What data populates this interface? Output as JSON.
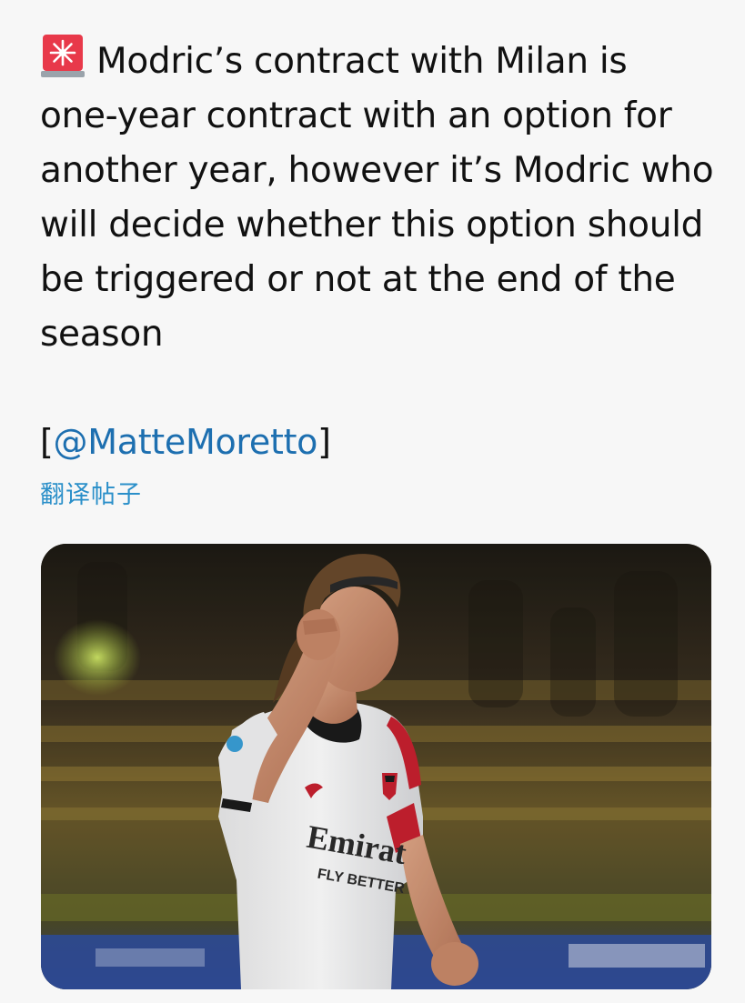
{
  "tweet": {
    "lines": [
      "Modric’s contract with Milan is",
      "one-year contract with an option for",
      "another year, however it’s Modric who",
      "will decide whether this option should",
      "be triggered or not at the end of the",
      "season"
    ],
    "mention_open": "[",
    "mention_handle": "@MatteMoretto",
    "mention_close": "]",
    "translate_label": "翻译帖子"
  },
  "media": {
    "alt": "Photo of a player in a white Milan away kit raising his fist",
    "shirt_sponsor_text": "Emirates FLY BETTER"
  },
  "icons": {
    "siren": "siren-icon"
  },
  "colors": {
    "background": "#f7f7f7",
    "link": "#1d6fb0",
    "translate": "#2a8fc9",
    "siren_red": "#e8394a"
  }
}
